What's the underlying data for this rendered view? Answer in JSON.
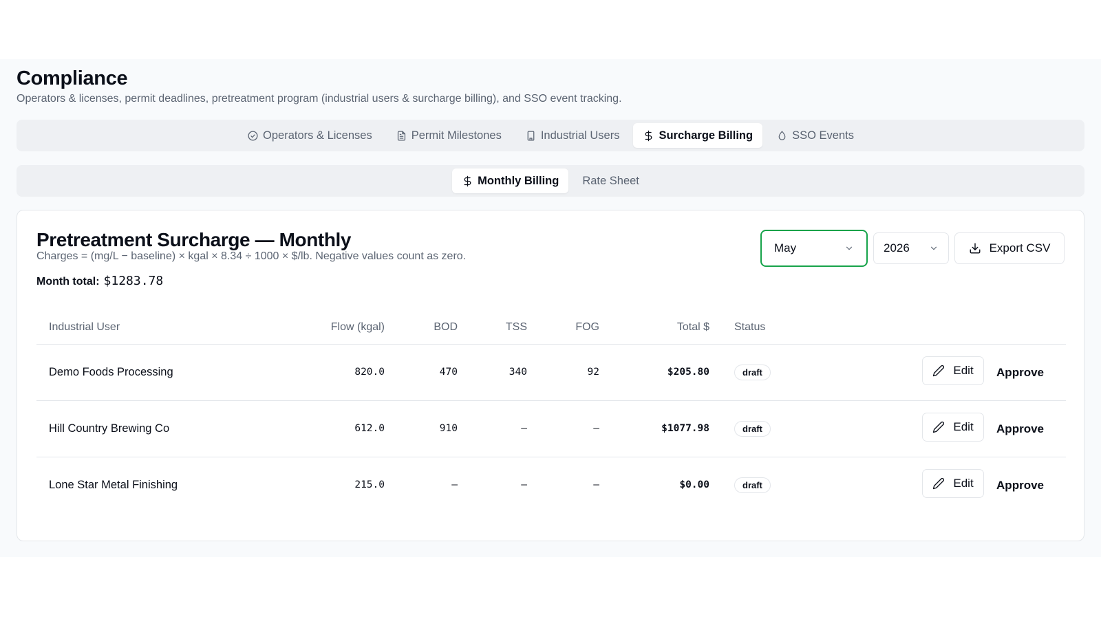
{
  "header": {
    "title": "Compliance",
    "subtitle": "Operators & licenses, permit deadlines, pretreatment program (industrial users & surcharge billing), and SSO event tracking."
  },
  "main_tabs": [
    {
      "label": "Operators & Licenses",
      "icon": "check-circle-icon",
      "active": false
    },
    {
      "label": "Permit Milestones",
      "icon": "document-icon",
      "active": false
    },
    {
      "label": "Industrial Users",
      "icon": "building-icon",
      "active": false
    },
    {
      "label": "Surcharge Billing",
      "icon": "dollar-icon",
      "active": true
    },
    {
      "label": "SSO Events",
      "icon": "droplet-icon",
      "active": false
    }
  ],
  "sub_tabs": [
    {
      "label": "Monthly Billing",
      "icon": "dollar-icon",
      "active": true
    },
    {
      "label": "Rate Sheet",
      "active": false
    }
  ],
  "card": {
    "title": "Pretreatment Surcharge — Monthly",
    "formula": "Charges = (mg/L − baseline) × kgal × 8.34 ÷ 1000 × $/lb. Negative values count as zero.",
    "month_total_label": "Month total:",
    "month_total_value": "$1283.78",
    "month_select": "May",
    "year_select": "2026",
    "export_label": "Export CSV",
    "accent_color": "#16a34a"
  },
  "table": {
    "headers": {
      "user": "Industrial User",
      "flow": "Flow (kgal)",
      "bod": "BOD",
      "tss": "TSS",
      "fog": "FOG",
      "total": "Total $",
      "status": "Status"
    },
    "rows": [
      {
        "user": "Demo Foods Processing",
        "flow": "820.0",
        "bod": "470",
        "tss": "340",
        "fog": "92",
        "total": "$205.80",
        "status": "draft",
        "edit": "Edit",
        "approve": "Approve"
      },
      {
        "user": "Hill Country Brewing Co",
        "flow": "612.0",
        "bod": "910",
        "tss": "–",
        "fog": "–",
        "total": "$1077.98",
        "status": "draft",
        "edit": "Edit",
        "approve": "Approve"
      },
      {
        "user": "Lone Star Metal Finishing",
        "flow": "215.0",
        "bod": "–",
        "tss": "–",
        "fog": "–",
        "total": "$0.00",
        "status": "draft",
        "edit": "Edit",
        "approve": "Approve"
      }
    ]
  }
}
